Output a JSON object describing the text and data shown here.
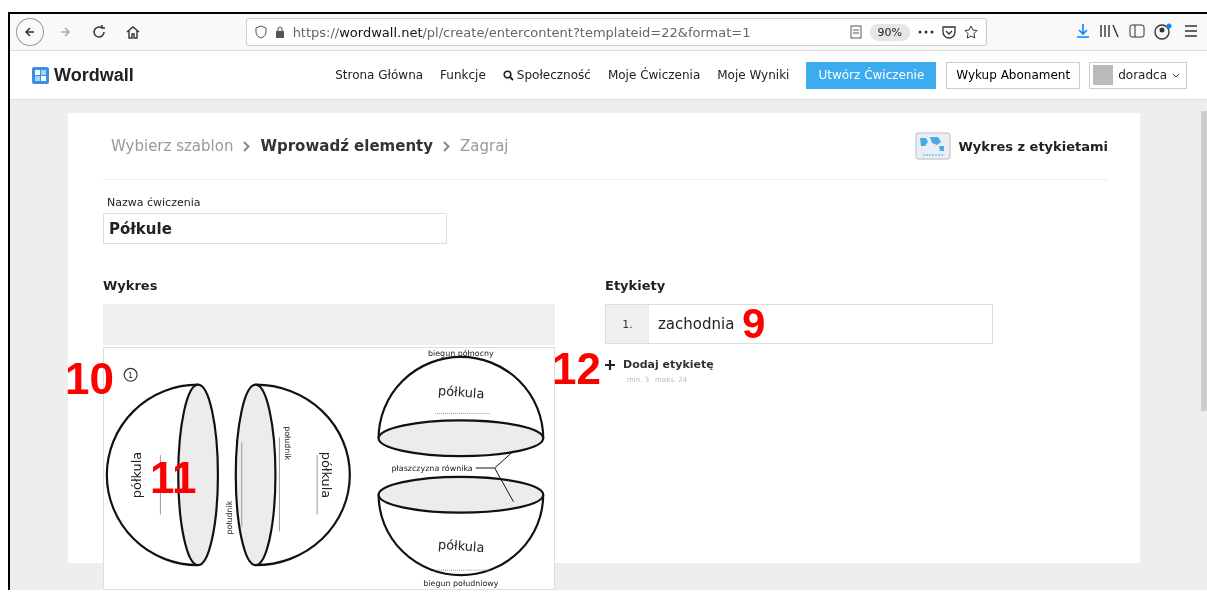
{
  "browser": {
    "url_prefix": "https://",
    "url_domain": "wordwall.net",
    "url_path": "/pl/create/entercontent?templateid=22&format=1",
    "zoom": "90%"
  },
  "site": {
    "logo": "Wordwall",
    "nav": [
      {
        "label": "Strona Główna",
        "kind": "link"
      },
      {
        "label": "Funkcje",
        "kind": "link"
      },
      {
        "label": "Społeczność",
        "kind": "search"
      },
      {
        "label": "Moje Ćwiczenia",
        "kind": "link"
      },
      {
        "label": "Moje Wyniki",
        "kind": "link"
      }
    ],
    "create_button": "Utwórz Ćwiczenie",
    "subscribe_button": "Wykup Abonament",
    "user": "doradca"
  },
  "breadcrumb": [
    {
      "label": "Wybierz szablon",
      "selected": false
    },
    {
      "label": "Wprowadź elementy",
      "selected": true
    },
    {
      "label": "Zagraj",
      "selected": false
    }
  ],
  "template": "Wykres z etykietami",
  "name_field": {
    "label": "Nazwa ćwiczenia",
    "value": "Półkule"
  },
  "diagram": {
    "heading": "Wykres",
    "marker": "1",
    "marker_annotation": "10",
    "image_annotation": "11",
    "north_pole": "biegun północny",
    "south_pole": "biegun południowy",
    "hemisphere_labels": [
      "półkula",
      "półkula",
      "półkula",
      "półkula"
    ],
    "meridian_labels": [
      "południk",
      "południk"
    ],
    "equator_plane": "płaszczyzna równika"
  },
  "labels": {
    "heading": "Etykiety",
    "items": [
      {
        "number": "1.",
        "text": "zachodnia",
        "annotation": "9"
      }
    ],
    "add_button": "Dodaj etykietę",
    "add_annotation": "12",
    "limits": [
      "min. 3",
      "maks. 24"
    ]
  }
}
